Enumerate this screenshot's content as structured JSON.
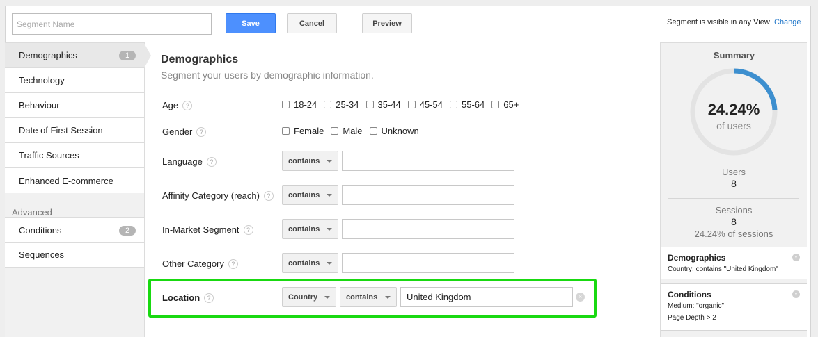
{
  "header": {
    "segment_name_placeholder": "Segment Name",
    "save_label": "Save",
    "cancel_label": "Cancel",
    "preview_label": "Preview",
    "visibility_text": "Segment is visible in any View",
    "change_label": "Change"
  },
  "sidebar": {
    "items": [
      {
        "label": "Demographics",
        "badge": "1"
      },
      {
        "label": "Technology"
      },
      {
        "label": "Behaviour"
      },
      {
        "label": "Date of First Session"
      },
      {
        "label": "Traffic Sources"
      },
      {
        "label": "Enhanced E-commerce"
      }
    ],
    "advanced_heading": "Advanced",
    "advanced_items": [
      {
        "label": "Conditions",
        "badge": "2"
      },
      {
        "label": "Sequences"
      }
    ]
  },
  "main": {
    "title": "Demographics",
    "subtitle": "Segment your users by demographic information.",
    "age": {
      "label": "Age",
      "options": [
        "18-24",
        "25-34",
        "35-44",
        "45-54",
        "55-64",
        "65+"
      ]
    },
    "gender": {
      "label": "Gender",
      "options": [
        "Female",
        "Male",
        "Unknown"
      ]
    },
    "language": {
      "label": "Language",
      "operator": "contains",
      "value": ""
    },
    "affinity": {
      "label": "Affinity Category (reach)",
      "operator": "contains",
      "value": ""
    },
    "in_market": {
      "label": "In-Market Segment",
      "operator": "contains",
      "value": ""
    },
    "other": {
      "label": "Other Category",
      "operator": "contains",
      "value": ""
    },
    "location": {
      "label": "Location",
      "dimension": "Country",
      "operator": "contains",
      "value": "United Kingdom"
    },
    "help_glyph": "?",
    "clear_glyph": "×",
    "highlight_color": "#19d911"
  },
  "summary": {
    "title": "Summary",
    "percent": "24.24%",
    "percent_fraction": 0.2424,
    "percent_label": "of users",
    "users_label": "Users",
    "users_value": "8",
    "sessions_label": "Sessions",
    "sessions_value": "8",
    "sessions_pct": "24.24% of sessions",
    "arc_color": "#3d8fcf",
    "cards": [
      {
        "title": "Demographics",
        "lines": [
          "Country: contains \"United Kingdom\""
        ]
      },
      {
        "title": "Conditions",
        "lines": [
          "Medium: \"organic\"",
          "Page Depth > 2"
        ]
      }
    ]
  }
}
